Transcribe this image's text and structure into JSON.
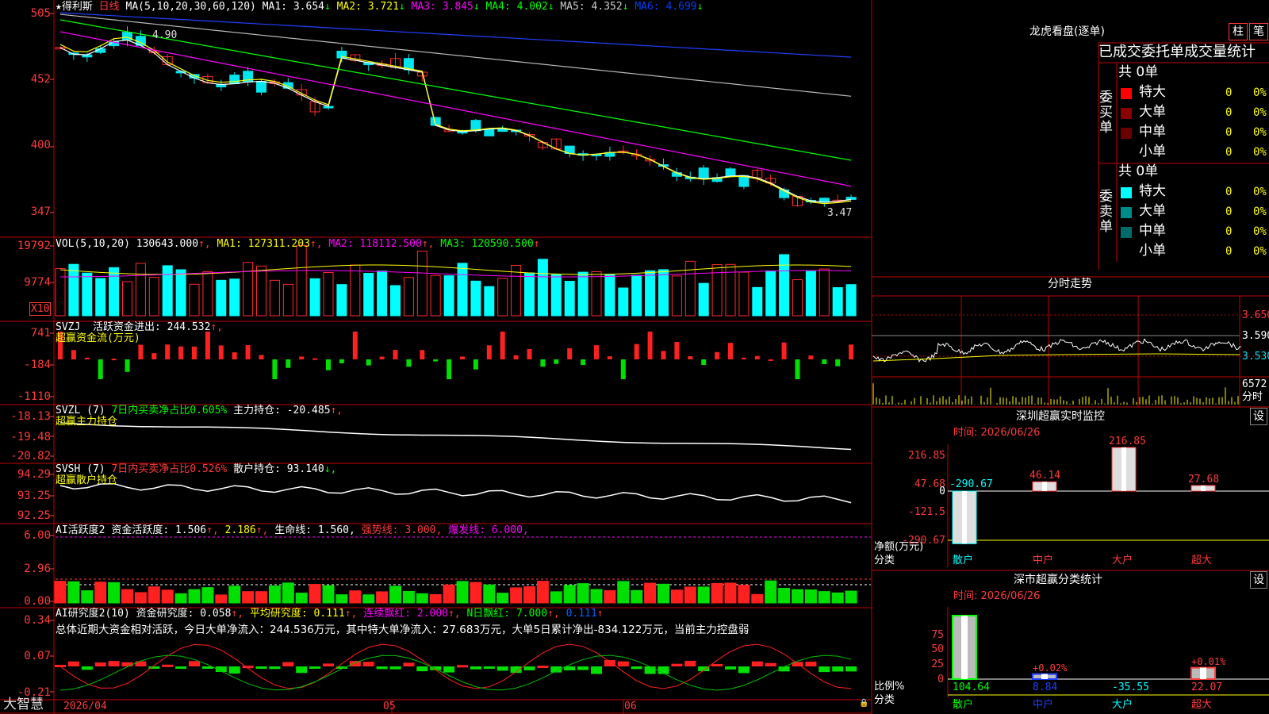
{
  "stock": {
    "name": "★得利斯",
    "period": "日线",
    "app": "大智慧"
  },
  "colors": {
    "red": "#ff2020",
    "cyan": "#00ffff",
    "grid": "#c00000",
    "up": "#ff2a2a",
    "down": "#00e5ee"
  },
  "kline": {
    "ma_line_prefix": "MA(5,10,20,30,60,120)",
    "ma_values": [
      {
        "label": "MA1:",
        "value": "3.654",
        "arrow": "↓",
        "color": "#ffffff"
      },
      {
        "label": "MA2:",
        "value": "3.721",
        "arrow": "↓",
        "color": "#ffff00"
      },
      {
        "label": "MA3:",
        "value": "3.845",
        "arrow": "↓",
        "color": "#ff00ff"
      },
      {
        "label": "MA4:",
        "value": "4.002",
        "arrow": "↓",
        "color": "#00ff00"
      },
      {
        "label": "MA5:",
        "value": "4.352",
        "arrow": "↓",
        "color": "#cccccc"
      },
      {
        "label": "MA6:",
        "value": "4.699",
        "arrow": "↓",
        "color": "#0040ff"
      }
    ],
    "y_ticks": [
      "505",
      "452",
      "400",
      "347"
    ],
    "hi_label": "4.90",
    "lo_label": "3.47"
  },
  "vol": {
    "title": "VOL(5,10,20)",
    "value": "130643.000",
    "ma1": "MA1: 127311.203",
    "ma2": "MA2: 118112.500",
    "ma3": "MA3: 120590.500",
    "y_ticks": [
      "19792",
      "9774"
    ],
    "unit": "X10"
  },
  "svzj": {
    "title": "SVZJ",
    "name": "活跃资金进出:",
    "value": "244.532",
    "sub": "超赢资金流(万元)",
    "y_ticks": [
      "741",
      "-184",
      "-1110"
    ]
  },
  "svzl": {
    "title": "SVZL (7)",
    "net": "7日内买卖净占比0.605%",
    "name": "主力持仓:",
    "value": "-20.485",
    "sub": "超赢主力持仓",
    "y_ticks": [
      "-18.13",
      "-19.48",
      "-20.82"
    ]
  },
  "svsh": {
    "title": "SVSH (7)",
    "net": "7日内买卖净占比0.526%",
    "name": "散户持仓:",
    "value": "93.140",
    "sub": "超赢散户持仓",
    "y_ticks": [
      "94.29",
      "93.25",
      "92.25"
    ]
  },
  "ai1": {
    "title": "AI活跃度2",
    "a": "资金活跃度: 1.506",
    "b": "2.186",
    "c": "生命线: 1.560",
    "d": "强势线: 3.000",
    "e": "爆发线: 6.000",
    "y_ticks": [
      "6.00",
      "2.96",
      "0.00"
    ]
  },
  "ai2": {
    "title": "AI研究度2(10)",
    "a": "资金研究度: 0.058",
    "b": "平均研究度: 0.111",
    "c": "连续飘红: 2.000",
    "d": "N日飘红: 7.000",
    "e": "0.111",
    "summary": "总体近期大资金相对活跃，今日大单净流入：244.536万元，其中特大单净流入：27.683万元，大单5日累计净出-834.122万元，当前主力控盘弱",
    "y_ticks": [
      "0.34",
      "0.07",
      "-0.21"
    ]
  },
  "xaxis": {
    "labels": [
      "2026/04",
      "05",
      "06"
    ]
  },
  "right": {
    "lhb_title": "龙虎看盘(逐单)",
    "btn_col": "柱",
    "btn_pen": "笔",
    "ob_title": "已成交委托单成交量统计",
    "buy_label": "委买单",
    "sell_label": "委卖单",
    "buy_total": "共 0单",
    "sell_total": "共 0单",
    "buy_rows": [
      {
        "name": "特大",
        "v": "0",
        "p": "0%",
        "c": "#ff0000"
      },
      {
        "name": "大单",
        "v": "0",
        "p": "0%",
        "c": "#8b0000"
      },
      {
        "name": "中单",
        "v": "0",
        "p": "0%",
        "c": "#6b0000"
      },
      {
        "name": "小单",
        "v": "0",
        "p": "0%",
        "c": ""
      }
    ],
    "sell_rows": [
      {
        "name": "特大",
        "v": "0",
        "p": "0%",
        "c": "#00ffff"
      },
      {
        "name": "大单",
        "v": "0",
        "p": "0%",
        "c": "#008b8b"
      },
      {
        "name": "中单",
        "v": "0",
        "p": "0%",
        "c": "#006b6b"
      },
      {
        "name": "小单",
        "v": "0",
        "p": "0%",
        "c": ""
      }
    ],
    "intraday_title": "分时走势",
    "intraday_ticks": [
      "3.650",
      "3.590",
      "3.530"
    ],
    "intraday_vol": "6572",
    "intraday_vol_unit": "分时",
    "sz_title": "深圳超赢实时监控",
    "set": "设",
    "time": "时间: 2026/06/26",
    "sz_ticks": [
      "216.85",
      "47.68",
      "0",
      "-121.5",
      "-290.67"
    ],
    "sz_unit": "净额(万元)",
    "cat_label": "分类",
    "sz_values": [
      {
        "cat": "散户",
        "v": -290.67,
        "label": "-290.67"
      },
      {
        "cat": "中户",
        "v": 46.14,
        "label": "46.14"
      },
      {
        "cat": "大户",
        "v": 216.85,
        "label": "216.85"
      },
      {
        "cat": "超大",
        "v": 27.68,
        "label": "27.68"
      }
    ],
    "st_title": "深市超赢分类统计",
    "time2": "时间: 2026/06/26",
    "st_ticks": [
      "75",
      "50",
      "25",
      "0"
    ],
    "st_unit": "比例%",
    "st_cat_label": "分类",
    "st_values": [
      {
        "cat": "散户",
        "pct": "",
        "val": "104.64",
        "h": 100
      },
      {
        "cat": "中户",
        "pct": "+0.02%",
        "val": "8.84",
        "h": 8
      },
      {
        "cat": "大户",
        "pct": "",
        "val": "-35.55",
        "h": 0
      },
      {
        "cat": "超大",
        "pct": "+0.01%",
        "val": "22.07",
        "h": 18
      }
    ]
  }
}
